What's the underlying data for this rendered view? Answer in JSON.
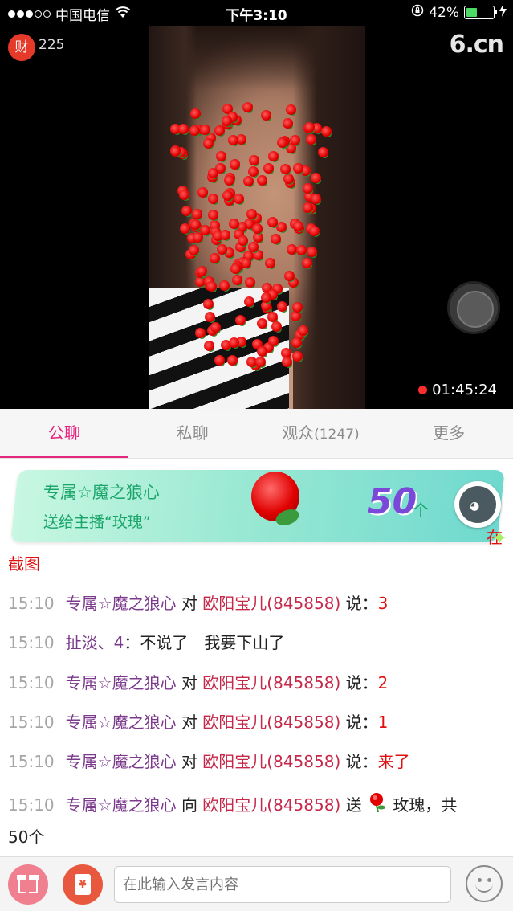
{
  "status_bar": {
    "carrier": "中国电信",
    "time": "下午3:10",
    "battery_percent": "42%",
    "battery_level": 0.42
  },
  "video": {
    "badge_icon": "财",
    "badge_count": "225",
    "logo": "6.cn",
    "record_time": "01:45:24"
  },
  "tabs": [
    {
      "label": "公聊",
      "active": true
    },
    {
      "label": "私聊"
    },
    {
      "label": "观众",
      "count": "(1247)"
    },
    {
      "label": "更多"
    }
  ],
  "gift_banner": {
    "sender": "专属☆魔之狼心",
    "message": "送给主播“玫瑰”",
    "count": "50",
    "unit": "个"
  },
  "chat": {
    "partial_top": "截图",
    "partial_ghost": "在",
    "messages": [
      {
        "time": "15:10",
        "user": "专属☆魔之狼心",
        "verb": "对",
        "target": "欧阳宝儿(845858)",
        "says": "说：",
        "text": "3"
      },
      {
        "time": "15:10",
        "user": "扯淡、4",
        "colon": "：",
        "text": "不说了　我要下山了"
      },
      {
        "time": "15:10",
        "user": "专属☆魔之狼心",
        "verb": "对",
        "target": "欧阳宝儿(845858)",
        "says": "说：",
        "text": "2"
      },
      {
        "time": "15:10",
        "user": "专属☆魔之狼心",
        "verb": "对",
        "target": "欧阳宝儿(845858)",
        "says": "说：",
        "text": "1"
      },
      {
        "time": "15:10",
        "user": "专属☆魔之狼心",
        "verb": "对",
        "target": "欧阳宝儿(845858)",
        "says": "说：",
        "text": "来了"
      },
      {
        "time": "15:10",
        "user": "专属☆魔之狼心",
        "verb": "向",
        "target": "欧阳宝儿(845858)",
        "says": "送",
        "gift_icon": "rose-icon",
        "text": "玫瑰，共",
        "text2": "50个"
      }
    ]
  },
  "bottom_bar": {
    "input_placeholder": "在此输入发言内容",
    "hongbao_char": "¥"
  }
}
